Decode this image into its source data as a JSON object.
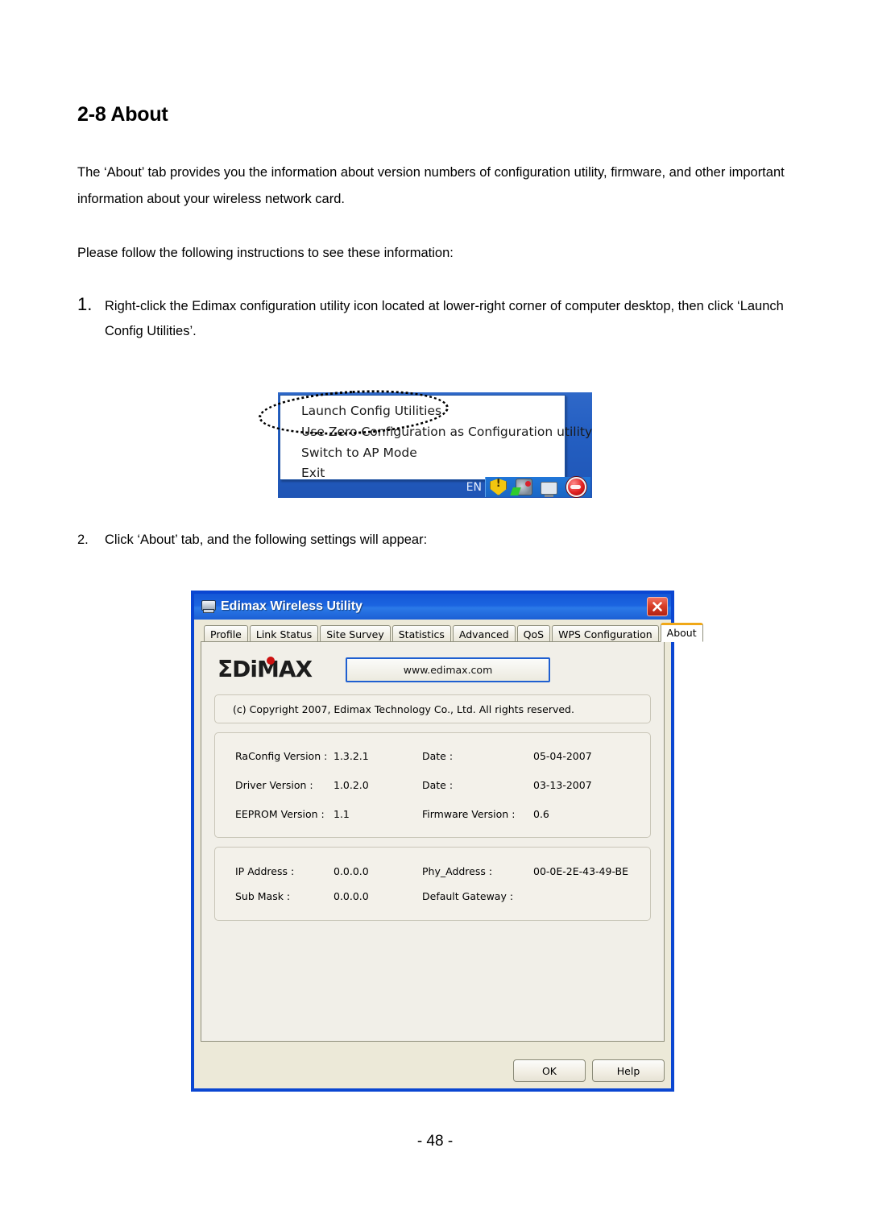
{
  "document": {
    "heading": "2-8 About",
    "intro_paragraph": "The ‘About’ tab provides you the information about version numbers of configuration utility, firmware, and other important information about your wireless network card.",
    "follow_paragraph": "Please follow the following instructions to see these information:",
    "steps": [
      {
        "number": "1.",
        "text": "Right-click the Edimax configuration utility icon located at lower-right corner of computer desktop, then click ‘Launch Config Utilities’."
      },
      {
        "number": "2.",
        "text": "Click ‘About’ tab, and the following settings will appear:"
      }
    ],
    "page_number": "- 48 -"
  },
  "tray_figure": {
    "menu_items": [
      "Launch Config Utilities",
      "Use Zero Configuration as Configuration utility",
      "Switch to AP Mode",
      "Exit"
    ],
    "language_indicator": "EN",
    "tray_icons": [
      "shield-warning-icon",
      "network-connection-icon",
      "monitor-icon",
      "edimax-utility-icon"
    ],
    "highlight_target": "Launch Config Utilities"
  },
  "dialog": {
    "title": "Edimax Wireless Utility",
    "title_icon": "monitor-icon",
    "close_label": "Close",
    "tabs": [
      {
        "label": "Profile",
        "active": false
      },
      {
        "label": "Link Status",
        "active": false
      },
      {
        "label": "Site Survey",
        "active": false
      },
      {
        "label": "Statistics",
        "active": false
      },
      {
        "label": "Advanced",
        "active": false
      },
      {
        "label": "QoS",
        "active": false
      },
      {
        "label": "WPS Configuration",
        "active": false
      },
      {
        "label": "About",
        "active": true
      }
    ],
    "active_tab_accent": "#f0a818",
    "brand": {
      "logo_text": "ΣDiMAX",
      "logo_dot_color": "#cc1111",
      "url_button_label": "www.edimax.com"
    },
    "copyright": "(c) Copyright 2007, Edimax Technology Co., Ltd. All rights reserved.",
    "version_info": [
      {
        "label_left": "RaConfig Version :",
        "value_left": "1.3.2.1",
        "label_right": "Date :",
        "value_right": "05-04-2007"
      },
      {
        "label_left": "Driver Version :",
        "value_left": "1.0.2.0",
        "label_right": "Date :",
        "value_right": "03-13-2007"
      },
      {
        "label_left": "EEPROM Version :",
        "value_left": "1.1",
        "label_right": "Firmware Version :",
        "value_right": "0.6"
      }
    ],
    "network_info": [
      {
        "label_left": "IP Address :",
        "value_left": "0.0.0.0",
        "label_right": "Phy_Address :",
        "value_right": "00-0E-2E-43-49-BE"
      },
      {
        "label_left": "Sub Mask :",
        "value_left": "0.0.0.0",
        "label_right": "Default Gateway :",
        "value_right": ""
      }
    ],
    "buttons": {
      "ok_label": "OK",
      "help_label": "Help"
    }
  }
}
